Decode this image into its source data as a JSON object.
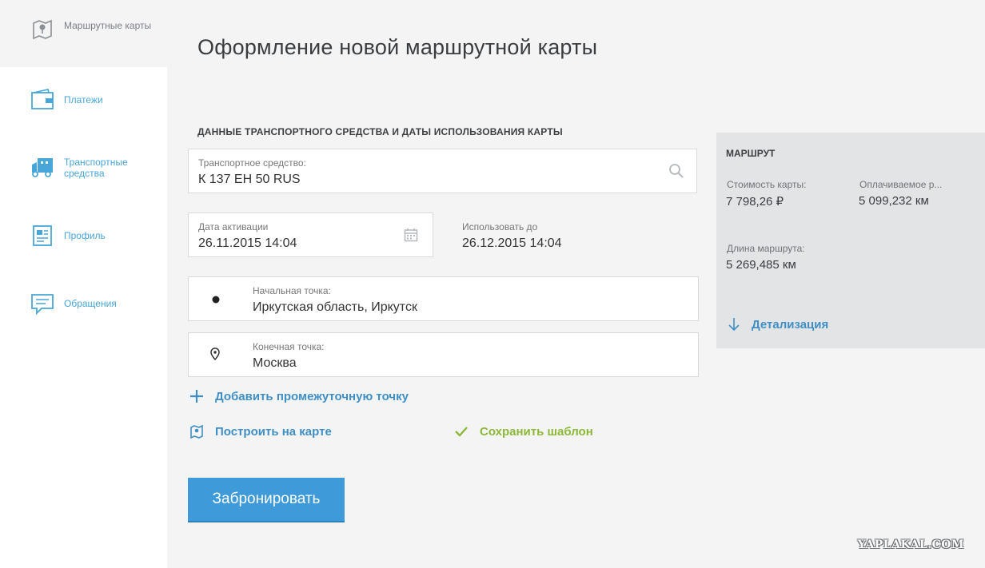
{
  "sidebar": {
    "items": [
      {
        "label": "Маршрутные карты",
        "icon": "map-icon",
        "active": true
      },
      {
        "label": "Платежи",
        "icon": "wallet-icon"
      },
      {
        "label": "Транспортные средства",
        "icon": "truck-icon"
      },
      {
        "label": "Профиль",
        "icon": "profile-icon"
      },
      {
        "label": "Обращения",
        "icon": "message-icon"
      }
    ]
  },
  "main": {
    "title": "Оформление новой маршрутной карты",
    "section_title": "ДАННЫЕ ТРАНСПОРТНОГО СРЕДСТВА И ДАТЫ ИСПОЛЬЗОВАНИЯ КАРТЫ",
    "vehicle": {
      "label": "Транспортное средство:",
      "value": "К 137 ЕН 50 RUS",
      "icon": "search-icon"
    },
    "activation": {
      "label": "Дата активации",
      "value": "26.11.2015 14:04",
      "icon": "calendar-icon"
    },
    "use_until": {
      "label": "Использовать до",
      "value": "26.12.2015 14:04"
    },
    "start_point": {
      "label": "Начальная точка:",
      "value": "Иркутская область, Иркутск",
      "icon": "dot-icon"
    },
    "end_point": {
      "label": "Конечная точка:",
      "value": "Москва",
      "icon": "pin-icon"
    },
    "add_point": "Добавить промежуточную точку",
    "build_on_map": "Построить на карте",
    "save_template": "Сохранить шаблон",
    "book_button": "Забронировать"
  },
  "route": {
    "title": "МАРШРУТ",
    "card_cost_label": "Стоимость карты:",
    "card_cost_value": "7 798,26 ₽",
    "paid_label": "Оплачиваемое р...",
    "paid_value": "5 099,232 км",
    "length_label": "Длина маршрута:",
    "length_value": "5 269,485 км",
    "details": "Детализация"
  },
  "watermark": "YAPLAKAL.COM",
  "colors": {
    "accent": "#3e9ad9",
    "link": "#3f8fc4",
    "success": "#8cb83a",
    "panel": "#e3e4e6"
  }
}
